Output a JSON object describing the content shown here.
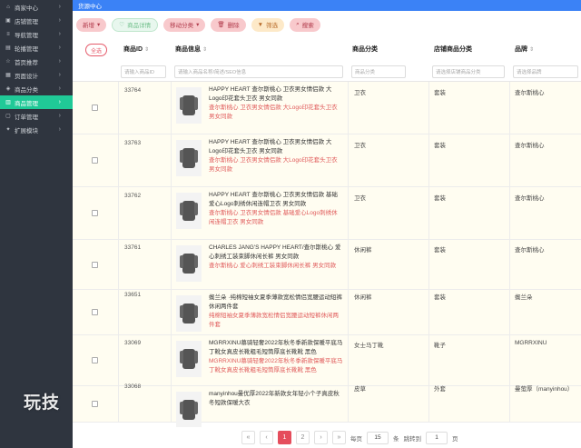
{
  "topbar": {
    "title": "货源中心"
  },
  "sidebar": {
    "items": [
      {
        "label": "商家中心",
        "icon": "home-icon",
        "active": false
      },
      {
        "label": "店铺管理",
        "icon": "shop-icon",
        "active": false
      },
      {
        "label": "导航管理",
        "icon": "nav-icon",
        "active": false
      },
      {
        "label": "轮播管理",
        "icon": "carousel-icon",
        "active": false
      },
      {
        "label": "首页推荐",
        "icon": "star-icon",
        "active": false
      },
      {
        "label": "页面设计",
        "icon": "page-icon",
        "active": false
      },
      {
        "label": "商品分类",
        "icon": "tag-icon",
        "active": false
      },
      {
        "label": "商品管理",
        "icon": "goods-icon",
        "active": true
      },
      {
        "label": "订单管理",
        "icon": "order-icon",
        "active": false
      },
      {
        "label": "扩展模块",
        "icon": "plugin-icon",
        "active": false
      }
    ]
  },
  "toolbar": {
    "new": "新增",
    "detail": "商品详情",
    "move": "移动分类",
    "delete": "删除",
    "filter": "筛选",
    "search": "搜索"
  },
  "table": {
    "all_label": "全选",
    "headers": {
      "id": "商品ID",
      "info": "商品信息",
      "cat": "商品分类",
      "store_cat": "店铺商品分类",
      "brand": "品牌"
    },
    "filters": {
      "id": "请输入商品ID",
      "info": "请输入商品名称/简述/SEO信息",
      "cat": "商品分类",
      "store_cat": "请选择店铺商品分类",
      "brand": "请选择品牌"
    },
    "rows": [
      {
        "id": "33764",
        "title": "HAPPY HEART 查尔斯桃心 卫衣男女情侣款 大Logo印花套头卫衣 男女同款",
        "sub": "查尔斯桃心 卫衣男女情侣款 大Logo印花套头卫衣 男女同款",
        "cat": "卫衣",
        "store_cat": "套装",
        "brand": "查尔斯桃心"
      },
      {
        "id": "33763",
        "title": "HAPPY HEART 查尔斯桃心 卫衣男女情侣款 大Logo印花套头卫衣 男女同款",
        "sub": "查尔斯桃心 卫衣男女情侣款 大Logo印花套头卫衣 男女同款",
        "cat": "卫衣",
        "store_cat": "套装",
        "brand": "查尔斯桃心"
      },
      {
        "id": "33762",
        "title": "HAPPY HEART 查尔斯桃心 卫衣男女情侣款 基础爱心Logo刺绣休闲连帽卫衣 男女同款",
        "sub": "查尔斯桃心 卫衣男女情侣款 基础爱心Logo刺绣休闲连帽卫衣 男女同款",
        "cat": "卫衣",
        "store_cat": "套装",
        "brand": "查尔斯桃心"
      },
      {
        "id": "33761",
        "title": "CHARLES JANG'S HAPPY HEART/查尔斯桃心 爱心刺绣工装束脚休闲长裤 男女同款",
        "sub": "查尔斯桃心 爱心刺绣工装束脚休闲长裤 男女同款",
        "cat": "休闲裤",
        "store_cat": "套装",
        "brand": "查尔斯桃心"
      },
      {
        "id": "33651",
        "title": "蜘兰朵 ·纯棉短袖女夏季薄款宽松情侣宽腰运动短裤休闲两件套",
        "sub": "纯棉短袖女夏季薄款宽松情侣宽腰运动短裤休闲两件套",
        "cat": "休闲裤",
        "store_cat": "套装",
        "brand": "蜘兰朵"
      },
      {
        "id": "33069",
        "title": "MGRRXINU慕骑轻奢2022年秋冬季新款保暖平底马丁靴女真皮长靴粗毛短筒厚底长靴靴 黑色",
        "sub": "MGRRXINU慕骑轻奢2022年秋冬季新款保暖平底马丁靴女真皮长靴粗毛短筒厚底长靴靴 黑色",
        "cat": "女士马丁靴",
        "store_cat": "靴子",
        "brand": "MGRRXINU"
      },
      {
        "id": "33068",
        "title": "manyinhou曼优厚2022年新款女年轻小个子真皮秋冬短款保暖大衣",
        "sub": "",
        "cat": "皮草",
        "store_cat": "外套",
        "brand": "曼萤厚（manyinhou）"
      }
    ]
  },
  "pager": {
    "first": "«",
    "prev": "‹",
    "p1": "1",
    "p2": "2",
    "next": "›",
    "last": "»",
    "per_page_label": "每页",
    "per_page": "15",
    "per_page_unit": "条",
    "jump_label": "跳转到",
    "jump_value": "1",
    "jump_unit": "页"
  },
  "watermark": "玩技",
  "colors": {
    "sidebar_bg": "#2f353f",
    "active": "#20c997",
    "topbar": "#3b82f6",
    "accent": "#e54d5c",
    "row_bg": "#fffdf1"
  }
}
